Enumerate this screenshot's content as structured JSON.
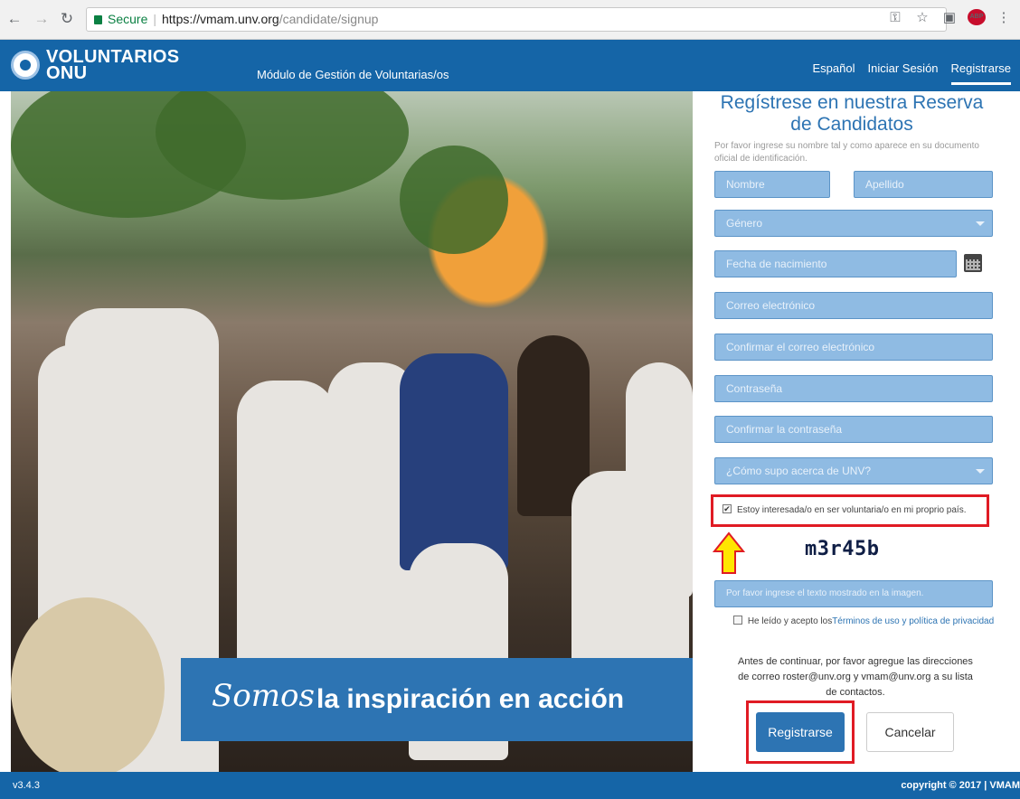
{
  "browser": {
    "secure_label": "Secure",
    "url_host": "https://vmam.unv.org",
    "url_path": "/candidate/signup"
  },
  "header": {
    "logo_line1": "VOLUNTARIOS",
    "logo_line2": "ONU",
    "module_title": "Módulo de Gestión de Voluntarias/os",
    "nav": {
      "language": "Español",
      "login": "Iniciar Sesión",
      "register": "Registrarse"
    }
  },
  "hero": {
    "slogan_script": "Somos",
    "slogan_rest": "la inspiración en acción"
  },
  "form": {
    "title": "Regístrese en nuestra Reserva de Candidatos",
    "hint": "Por favor ingrese su nombre tal y como aparece en su documento oficial de identificación.",
    "fields": {
      "first_name": "Nombre",
      "last_name": "Apellido",
      "gender": "Género",
      "birth_date": "Fecha de nacimiento",
      "email": "Correo electrónico",
      "email_confirm": "Confirmar el correo electrónico",
      "password": "Contraseña",
      "password_confirm": "Confirmar la contraseña",
      "source": "¿Cómo supo acerca de UNV?"
    },
    "home_country_check": "Estoy interesada/o en ser voluntaria/o en mi proprio país.",
    "captcha_text": "m3r45b",
    "captcha_placeholder": "Por favor ingrese el texto mostrado en la imagen.",
    "terms_prefix": "He leído y acepto los",
    "terms_link": "Términos de uso y política de privacidad",
    "notice": "Antes de continuar, por favor agregue las direcciones de correo roster@unv.org y vmam@unv.org a su lista de contactos.",
    "register_button": "Registrarse",
    "cancel_button": "Cancelar"
  },
  "footer": {
    "version": "v3.4.3",
    "copyright": "copyright © 2017 | VMAM"
  },
  "colors": {
    "brand_blue": "#1565a7",
    "accent_blue": "#2d74b3",
    "field_blue": "#8fbbe3",
    "highlight_red": "#e01b24",
    "arrow_yellow": "#ffe600"
  }
}
